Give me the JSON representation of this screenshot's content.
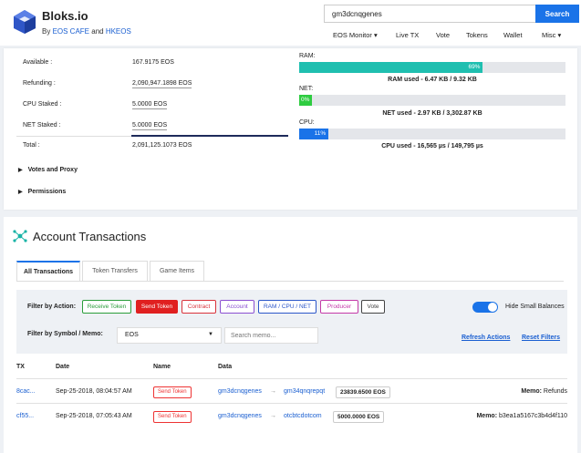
{
  "header": {
    "brand": "Bloks.io",
    "byline_prefix": "By ",
    "byline_link1": "EOS CAFE",
    "byline_and": " and ",
    "byline_link2": "HKEOS",
    "search_value": "gm3dcnqgenes",
    "search_button": "Search",
    "nav": [
      "EOS Monitor ▾",
      "Live TX",
      "Vote",
      "Tokens",
      "Wallet",
      "Misc ▾"
    ]
  },
  "balances": {
    "available_label": "Available :",
    "available_value": "167.9175 EOS",
    "refunding_label": "Refunding :",
    "refunding_value": "2,090,947.1898 EOS",
    "cpu_label": "CPU Staked :",
    "cpu_value": "5.0000 EOS",
    "net_label": "NET Staked :",
    "net_value": "5.0000 EOS",
    "total_label": "Total :",
    "total_value": "2,091,125.1073 EOS"
  },
  "resources": {
    "ram_label": "RAM:",
    "ram_pct": 69,
    "ram_pct_text": "69%",
    "ram_caption": "RAM used - 6.47 KB / 9.32 KB",
    "ram_color": "#1fbfb0",
    "net_label": "NET:",
    "net_pct": 0,
    "net_pct_text": "0%",
    "net_caption": "NET used - 2.97 KB / 3,302.87 KB",
    "net_color": "#2ecc40",
    "cpu_label": "CPU:",
    "cpu_pct": 11,
    "cpu_pct_text": "11%",
    "cpu_caption": "CPU used - 16,565 µs / 149,795 µs",
    "cpu_color": "#1a73e8"
  },
  "sections": {
    "votes": "Votes and Proxy",
    "permissions": "Permissions"
  },
  "transactions": {
    "title": "Account Transactions",
    "tabs": [
      "All Transactions",
      "Token Transfers",
      "Game Items"
    ],
    "filter_action_label": "Filter by Action:",
    "chips": [
      {
        "label": "Receive Token",
        "color": "#2a9d3a"
      },
      {
        "label": "Send Token",
        "color": "#e02020"
      },
      {
        "label": "Contract",
        "color": "#d9323a"
      },
      {
        "label": "Account",
        "color": "#8a4fd1"
      },
      {
        "label": "RAM / CPU / NET",
        "color": "#2c57c9"
      },
      {
        "label": "Producer",
        "color": "#c43aa8"
      },
      {
        "label": "Vote",
        "color": "#444444"
      }
    ],
    "hide_small_label": "Hide Small Balances",
    "filter_symbol_label": "Filter by Symbol / Memo:",
    "symbol_value": "EOS",
    "memo_placeholder": "Search memo...",
    "refresh_link": "Refresh Actions",
    "reset_link": "Reset Filters",
    "columns": [
      "TX",
      "Date",
      "Name",
      "Data"
    ],
    "rows": [
      {
        "tx": "8cac...",
        "date": "Sep-25-2018, 08:04:57 AM",
        "name": "Send Token",
        "from": "gm3dcnqgenes",
        "to": "gm34qnqrepqt",
        "amount": "23839.6500 EOS",
        "memo_label": "Memo:",
        "memo": "Refunds"
      },
      {
        "tx": "cf55...",
        "date": "Sep-25-2018, 07:05:43 AM",
        "name": "Send Token",
        "from": "gm3dcnqgenes",
        "to": "otcbtcdotcom",
        "amount": "5000.0000 EOS",
        "memo_label": "Memo:",
        "memo": "b3ea1a5167c3b4d4f110"
      }
    ]
  }
}
